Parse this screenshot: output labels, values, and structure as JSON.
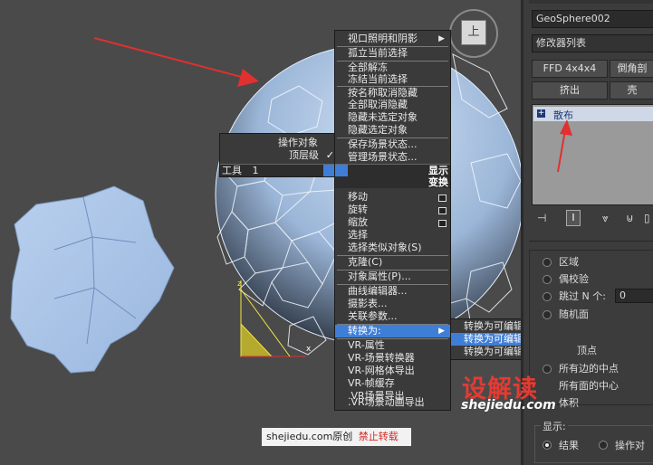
{
  "viewcube_label": "上",
  "context_menu_left": {
    "items": [
      {
        "label": "操作对象",
        "checked": false
      },
      {
        "label": "顶层级",
        "checked": true
      }
    ],
    "tools_header": {
      "label": "工具",
      "index": "1"
    }
  },
  "context_menu_right": {
    "display_header": "显示",
    "transform_header": "变换",
    "items_display": [
      {
        "label": "视口照明和阴影",
        "submenu": true
      },
      {
        "label": "孤立当前选择"
      },
      {
        "label": "全部解冻"
      },
      {
        "label": "冻结当前选择"
      },
      {
        "label": "按名称取消隐藏"
      },
      {
        "label": "全部取消隐藏"
      },
      {
        "label": "隐藏未选定对象"
      },
      {
        "label": "隐藏选定对象"
      },
      {
        "label": "保存场景状态..."
      },
      {
        "label": "管理场景状态..."
      }
    ],
    "items_transform": [
      {
        "label": "移动",
        "option_box": true
      },
      {
        "label": "旋转",
        "option_box": true
      },
      {
        "label": "缩放",
        "option_box": true
      },
      {
        "label": "选择"
      },
      {
        "label": "选择类似对象(S)"
      },
      {
        "label": "克隆(C)"
      },
      {
        "label": "对象属性(P)..."
      },
      {
        "label": "曲线编辑器..."
      },
      {
        "label": "摄影表..."
      },
      {
        "label": "关联参数..."
      },
      {
        "label": "转换为:",
        "submenu": true,
        "highlighted": true
      },
      {
        "label": "VR-属性"
      },
      {
        "label": "VR-场景转换器"
      },
      {
        "label": "VR-网格体导出"
      },
      {
        "label": "VR-帧缓存"
      },
      {
        "label": ".VR场景导出"
      },
      {
        "label": ".VR场景动画导出"
      }
    ]
  },
  "convert_submenu": {
    "items": [
      {
        "label": "转换为可编辑网格",
        "highlighted": false
      },
      {
        "label": "转换为可编辑多边形",
        "highlighted": true
      },
      {
        "label": "转换为可编辑面片",
        "highlighted": false
      }
    ]
  },
  "command_panel": {
    "object_name": "GeoSphere002",
    "modifier_list_label": "修改器列表",
    "buttons": [
      "FFD 4x4x4",
      "倒角剖",
      "挤出",
      "壳"
    ],
    "stack_item": {
      "expand": "+",
      "label": "散布"
    },
    "selection_options": [
      {
        "label": "区域",
        "selected": false
      },
      {
        "label": "偶校验",
        "selected": false
      },
      {
        "label": "跳过 N 个:",
        "selected": false,
        "value": "0"
      },
      {
        "label": "随机面",
        "selected": false
      },
      {
        "label": "顶点",
        "selected": false
      },
      {
        "label": "所有边的中点",
        "selected": false
      },
      {
        "label": "所有面的中心",
        "selected": false
      },
      {
        "label": "体积",
        "selected": false
      }
    ],
    "display_group": {
      "title": "显示:",
      "options": [
        {
          "label": "结果",
          "selected": true
        },
        {
          "label": "操作对",
          "selected": false
        }
      ]
    }
  },
  "watermark": {
    "site_text": "shejiedu.com原创",
    "forbid_text": "禁止转载",
    "brand_cn": "设解读",
    "brand_url": "shejiedu.com"
  },
  "colors": {
    "highlight": "#3f7ed7",
    "menu_bg": "#3a3a3a",
    "arrow_red": "#e03030",
    "brand_red": "#e23b34"
  }
}
